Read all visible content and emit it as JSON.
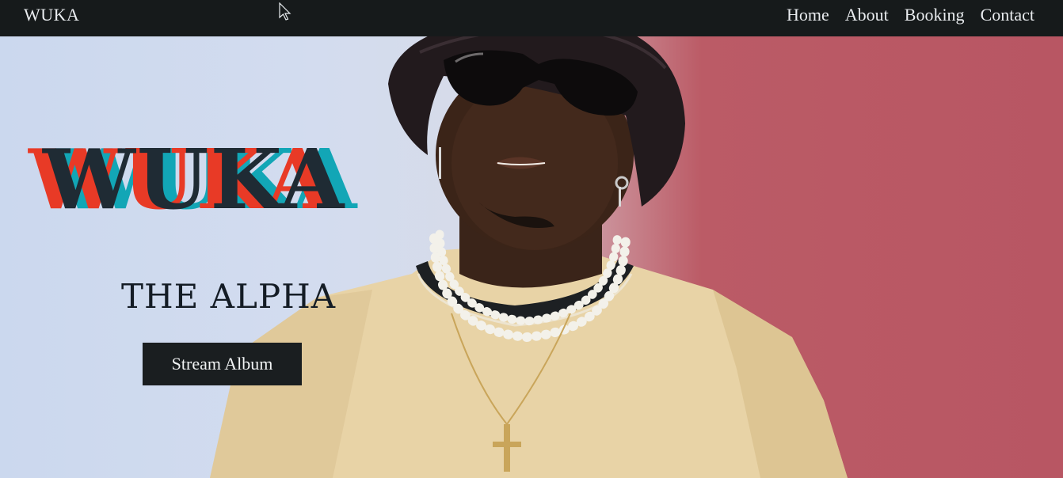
{
  "navbar": {
    "brand": "WUKA",
    "links": [
      "Home",
      "About",
      "Booking",
      "Contact"
    ]
  },
  "hero": {
    "title": "WUKA",
    "subtitle": "THE ALPHA",
    "cta_label": "Stream Album"
  },
  "colors": {
    "navbar_bg": "#161a1b",
    "title_cyan": "#12a6b6",
    "title_red": "#e83a26",
    "title_dark": "#1f2b34",
    "button_bg": "#1a1e20",
    "backdrop_left": "#cbd8ee",
    "backdrop_right": "#b85663"
  },
  "icons": {
    "cursor": "mouse-pointer-icon"
  }
}
